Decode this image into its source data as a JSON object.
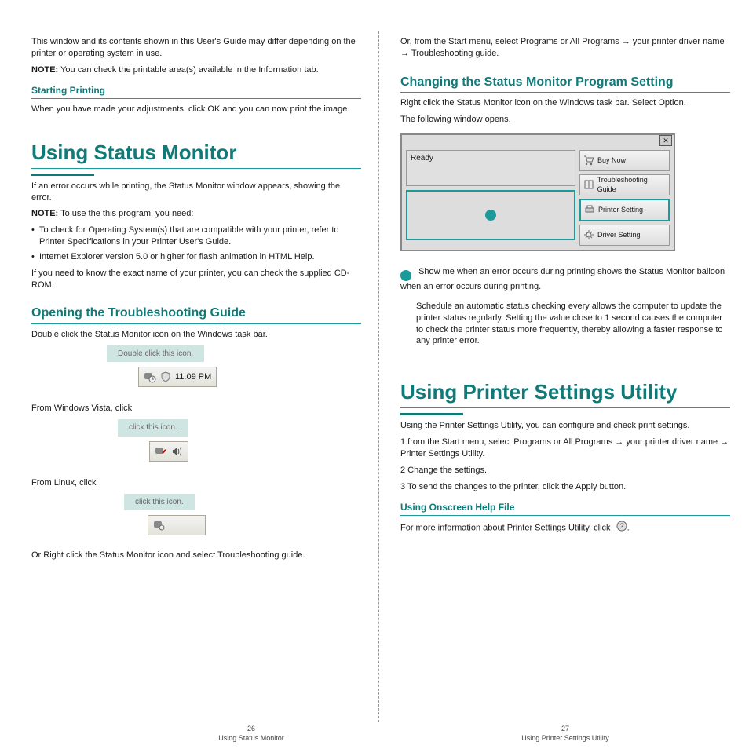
{
  "left": {
    "top_lines": "This window and its contents shown in this User's Guide may differ depending on the printer or operating system in use.",
    "note_label": "NOTE:",
    "note_text": "You can check the printable area(s) available in the Information tab.",
    "print_heading": "Starting Printing",
    "print_body": "When you have made your adjustments, click OK and you can now print the image.",
    "page_title": "Using Status Monitor",
    "para1": "If an error occurs while printing, the Status Monitor window appears, showing the error.",
    "note2_text": "To use the this program, you need:",
    "note2_bullets": [
      "To check for Operating System(s) that are compatible with your printer, refer to Printer Specifications in your Printer User's Guide.",
      "Internet Explorer version 5.0 or higher for flash animation in HTML Help."
    ],
    "note2_tail": "If you need to know the exact name of your printer, you can check the supplied CD-ROM.",
    "section_open": "Opening the Troubleshooting Guide",
    "section_open_body": "Double click the Status Monitor icon on the Windows task bar.",
    "doubleclick_tag": "Double click this icon.",
    "tray_xp_time": "11:09 PM",
    "vista_line": "From Windows Vista, click",
    "vista_tag": "click this icon.",
    "linux_line": "From Linux, click",
    "linux_tag": "click this icon.",
    "right_click": "Or Right click the Status Monitor icon and select Troubleshooting guide."
  },
  "right": {
    "or_line_pre": "Or, from the Start menu, select Programs or All Programs",
    "arrow": "→",
    "or_mid": "your printer driver name",
    "or_end": "Troubleshooting guide.",
    "section_change": "Changing the Status Monitor Program Setting",
    "change_body": "Right click the Status Monitor icon on the Windows task bar. Select Option.",
    "change_body2": "The following window opens.",
    "panel": {
      "status_text": "Ready",
      "btn_buy": "Buy Now",
      "btn_ts": "Troubleshooting Guide",
      "btn_ps": "Printer Setting",
      "btn_ds": "Driver Setting"
    },
    "callout1": "Show me when an error occurs during printing shows the Status Monitor balloon when an error occurs during printing.",
    "callout2": "Schedule an automatic status checking every allows the computer to update the printer status regularly. Setting the value close to 1 second causes the computer to check the printer status more frequently, thereby allowing a faster response to any printer error.",
    "section_util": "Using Printer Settings Utility",
    "util_body": "Using the Printer Settings Utility, you can configure and check print settings.",
    "util_step1": "1  from the Start menu, select Programs or All Programs",
    "util_step1_mid": "your printer driver name",
    "util_step1_end": "Printer Settings Utility.",
    "util_step2": "2  Change the settings.",
    "util_step3": "3  To send the changes to the printer, click the Apply button.",
    "util_help_heading": "Using Onscreen Help File",
    "util_help_body": "For more information about Printer Settings Utility, click"
  },
  "footer": {
    "page_no_left": "26",
    "page_no_right": "27",
    "label_left": "Using Status Monitor",
    "label_right": "Using Printer Settings Utility"
  }
}
